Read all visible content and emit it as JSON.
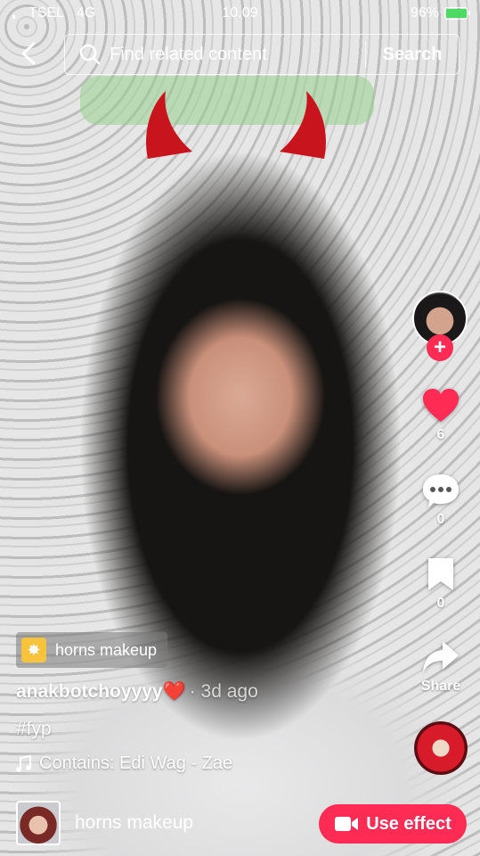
{
  "status_bar": {
    "carrier": "TSEL",
    "network": "4G",
    "time": "10.09",
    "battery": "96%",
    "battery_level": 0.96
  },
  "search": {
    "placeholder": "Find related content",
    "button_label": "Search"
  },
  "rail": {
    "likes": "6",
    "comments": "0",
    "bookmarks": "0",
    "share_label": "Share",
    "follow_symbol": "+"
  },
  "effect_chip": {
    "label": "horns makeup",
    "icon": "sparkle-icon"
  },
  "post": {
    "username": "anakbotchoyyyy",
    "username_emoji": "❤️",
    "time_ago": "· 3d ago",
    "caption": "#fyp",
    "sound": "Contains: Edi Wag - Zae"
  },
  "bottom": {
    "effect_name": "horns makeup",
    "use_effect_label": "Use effect"
  },
  "colors": {
    "accent": "#fe2c55",
    "like": "#fe2c55",
    "chip_icon": "#f7c33c",
    "battery_fill": "#4cd964"
  }
}
